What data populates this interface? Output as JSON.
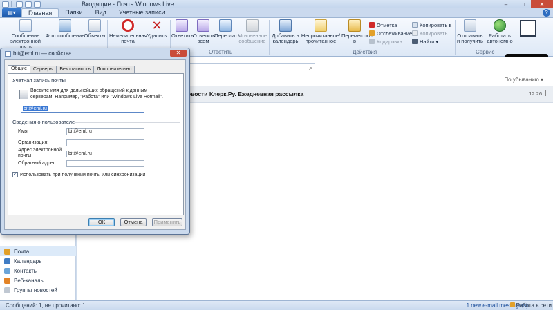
{
  "window": {
    "title": "Входящие - Почта Windows Live",
    "controls": [
      "–",
      "□",
      "✕"
    ]
  },
  "tabs": [
    {
      "label": "Главная",
      "active": true
    },
    {
      "label": "Папки"
    },
    {
      "label": "Вид"
    },
    {
      "label": "Учетные записи"
    }
  ],
  "ribbon": {
    "new_email": "Сообщение электронной почты",
    "photo_message": "Фотосообщение",
    "items": "Объекты",
    "junk": "Нежелательная почта",
    "delete": "Удалить",
    "reply": "Ответить",
    "reply_all": "Ответить всем",
    "forward": "Переслать",
    "instant_message": "Мгновенное сообщение",
    "respond_group": "Ответить",
    "add_to_calendar": "Добавить в календарь",
    "unread_read": "Непрочитанное/ прочитанное",
    "move_to": "Переместить в",
    "actions_group": "Действия",
    "flag": "Отметка",
    "watch": "Отслеживание",
    "encoding": "Кодировка",
    "copy_to": "Копировать в",
    "copy": "Копировать",
    "find": "Найти",
    "send_receive": "Отправить и получить",
    "work_offline": "Работать автономно",
    "tools_group": "Сервис"
  },
  "nav": [
    {
      "label": "Почта",
      "icon": "mail-icon",
      "selected": true
    },
    {
      "label": "Календарь",
      "icon": "calendar-icon"
    },
    {
      "label": "Контакты",
      "icon": "contacts-icon"
    },
    {
      "label": "Веб-каналы",
      "icon": "feeds-icon"
    },
    {
      "label": "Группы новостей",
      "icon": "newsgroups-icon"
    }
  ],
  "list": {
    "sort": "По убыванию ▾",
    "message_subject": "овости Клерк.Ру. Ежедневная рассылка",
    "message_time": "12:26"
  },
  "status": {
    "left": "Сообщений: 1, не прочитано: 1",
    "right": "1 new e-mail message(s)",
    "offline": "Работа в сети"
  },
  "dialog": {
    "title": "bit@eml.ru — свойства",
    "tabs": [
      "Общие",
      "Серверы",
      "Безопасность",
      "Дополнительно"
    ],
    "account_section": "Учетная запись почты",
    "account_desc": "Введите имя для дальнейших обращений к данным серверам. Например, \"Работа\" или \"Windows Live Hotmail\".",
    "account_name": "bit@eml.ru",
    "user_section": "Сведения о пользователе",
    "name_label": "Имя:",
    "name_value": "bit@eml.ru",
    "org_label": "Организация:",
    "org_value": "",
    "email_label": "Адрес электронной почты:",
    "email_value": "bit@eml.ru",
    "reply_label": "Обратный адрес:",
    "reply_value": "",
    "checkbox_label": "Использовать при получении почты или синхронизации",
    "checkbox_checked": true,
    "ok": "ОК",
    "cancel": "Отмена",
    "apply": "Применить"
  },
  "colors": {
    "accent": "#2d6cc0",
    "ribbon_bg": "#dde8f6",
    "close_red": "#c94c3a"
  }
}
